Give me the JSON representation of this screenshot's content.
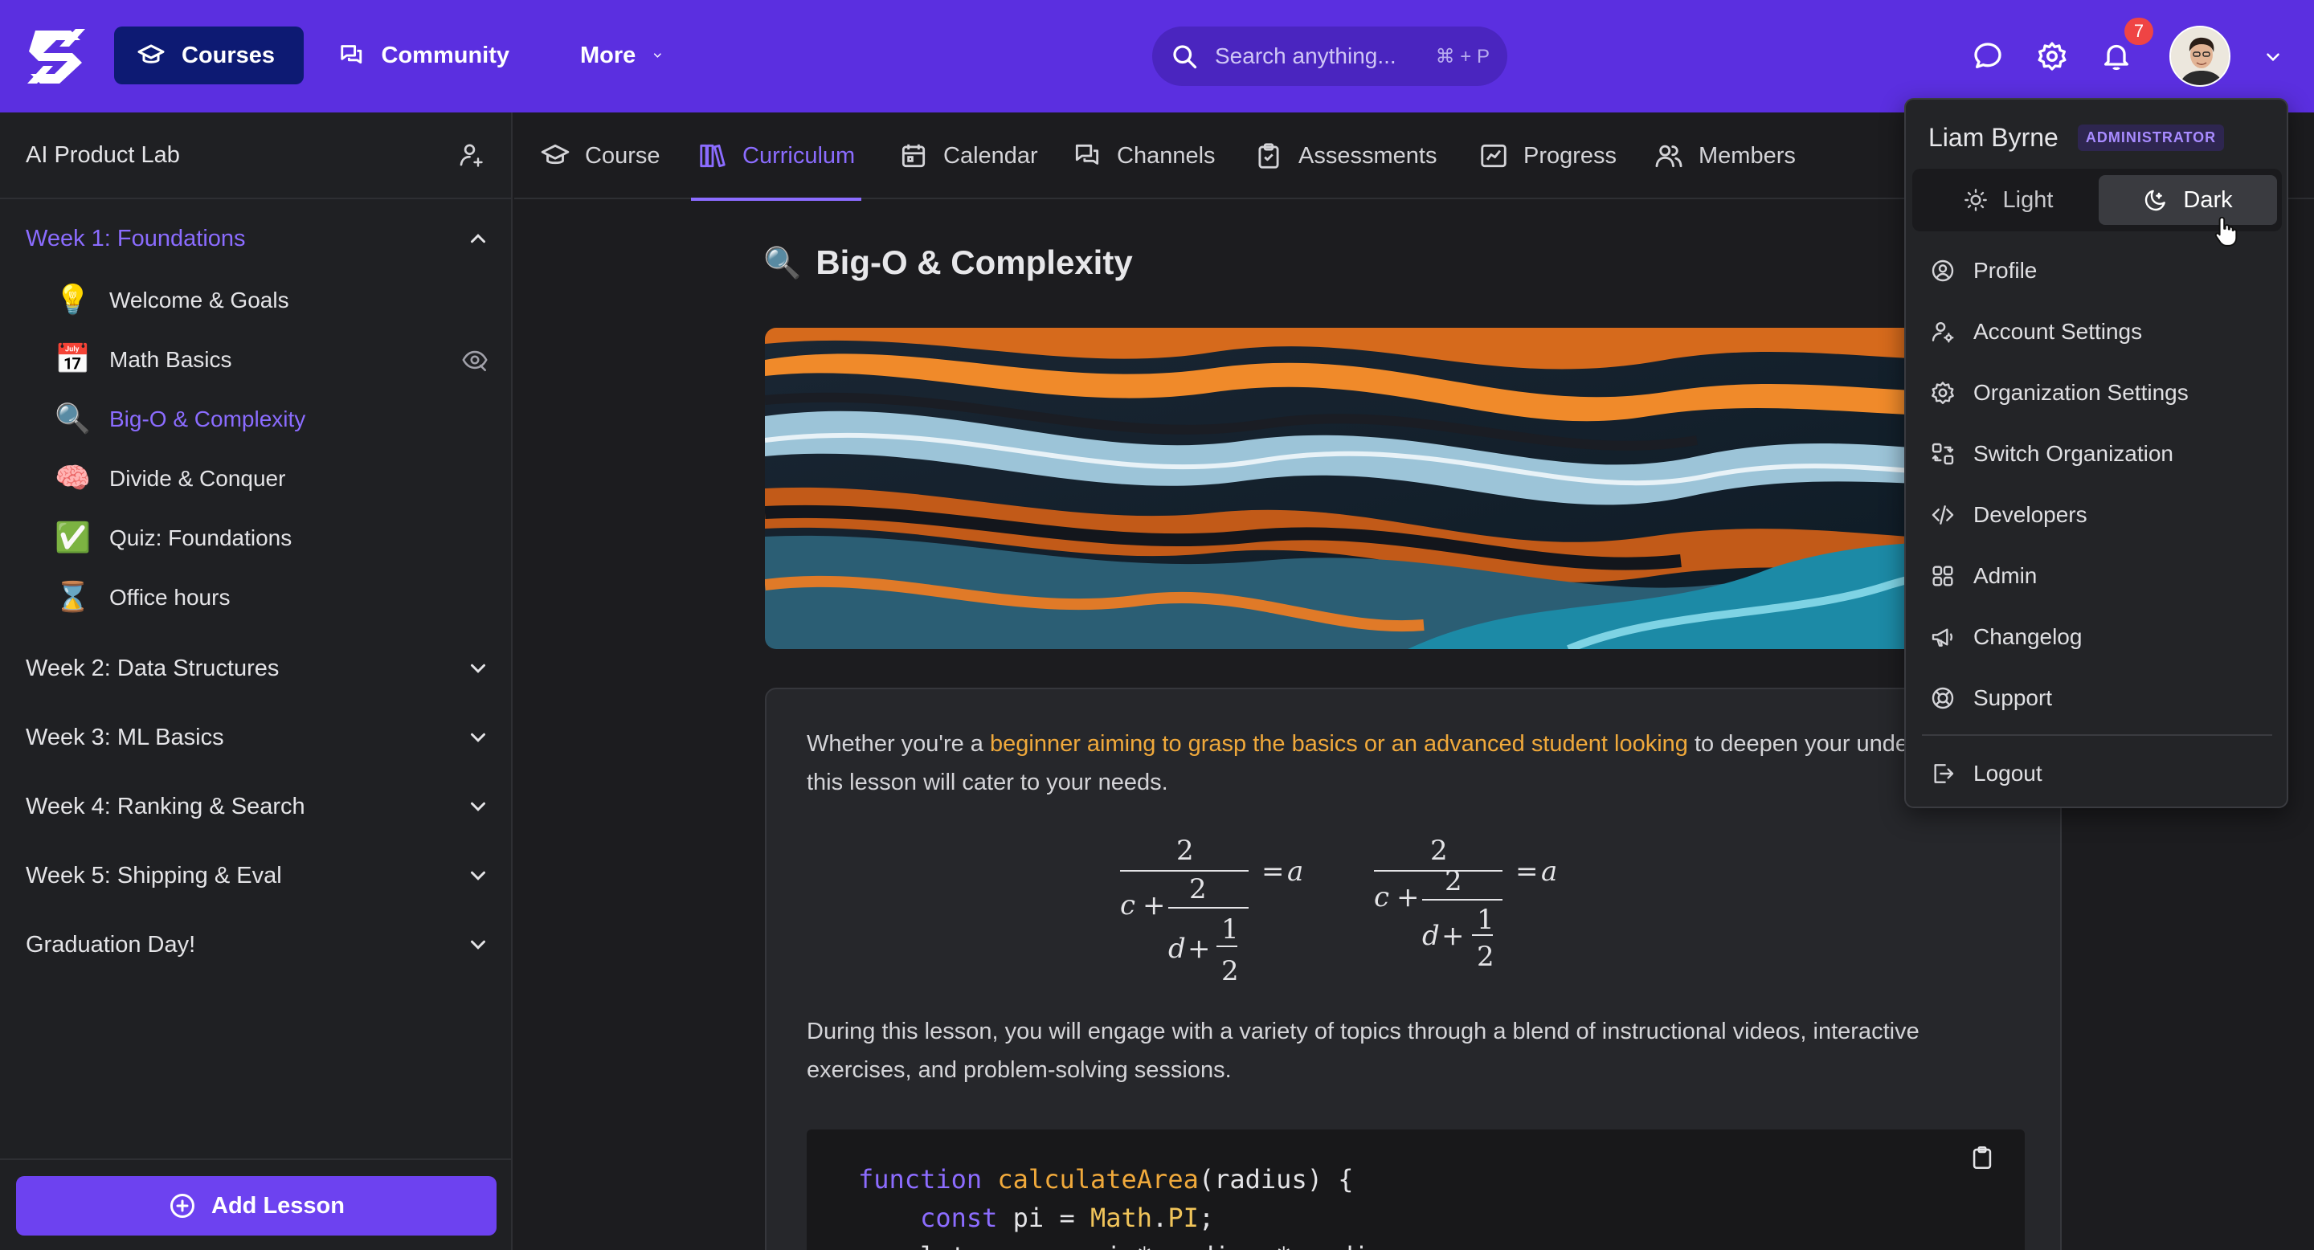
{
  "topbar": {
    "nav": [
      {
        "label": "Courses",
        "icon": "graduation-cap-icon"
      },
      {
        "label": "Community",
        "icon": "chat-bubbles-icon"
      },
      {
        "label": "More",
        "icon": "chevron-down-icon"
      }
    ],
    "search_placeholder": "Search anything...",
    "search_shortcut": "⌘ + P",
    "notification_count": "7"
  },
  "sidebar": {
    "title": "AI Product Lab",
    "weeks": [
      {
        "label": "Week 1: Foundations",
        "expanded": true
      },
      {
        "label": "Week 2: Data Structures",
        "expanded": false
      },
      {
        "label": "Week 3: ML Basics",
        "expanded": false
      },
      {
        "label": "Week 4: Ranking & Search",
        "expanded": false
      },
      {
        "label": "Week 5: Shipping & Eval",
        "expanded": false
      },
      {
        "label": "Graduation Day!",
        "expanded": false
      }
    ],
    "lessons": [
      {
        "emoji": "💡",
        "label": "Welcome & Goals"
      },
      {
        "emoji": "📅",
        "label": "Math Basics"
      },
      {
        "emoji": "🔍",
        "label": "Big-O & Complexity"
      },
      {
        "emoji": "🧠",
        "label": "Divide & Conquer"
      },
      {
        "emoji": "✅",
        "label": "Quiz: Foundations"
      },
      {
        "emoji": "⌛",
        "label": "Office hours"
      }
    ],
    "add_lesson_label": "Add Lesson"
  },
  "tabs": [
    {
      "label": "Course"
    },
    {
      "label": "Curriculum"
    },
    {
      "label": "Calendar"
    },
    {
      "label": "Channels"
    },
    {
      "label": "Assessments"
    },
    {
      "label": "Progress"
    },
    {
      "label": "Members"
    }
  ],
  "content": {
    "title_emoji": "🔍",
    "title": "Big-O & Complexity",
    "intro_before": "Whether you're a ",
    "intro_highlight": "beginner aiming to grasp the basics or an advanced student looking",
    "intro_after": " to deepen your understanding, this lesson will cater to your needs.",
    "body_paragraph": "During this lesson, you will engage with a variety of topics through a blend of instructional videos, interactive exercises, and problem-solving sessions.",
    "code": {
      "line1_kw": "function",
      "line1_fn": "calculateArea",
      "line1_rest": "(radius) {",
      "line2_kw": "const",
      "line2_mid": " pi = ",
      "line2_obj": "Math",
      "line2_dot": ".",
      "line2_prop": "PI",
      "line2_end": ";",
      "line3": "    let area = pi * radius * radius;"
    }
  },
  "menu": {
    "user_name": "Liam Byrne",
    "role": "ADMINISTRATOR",
    "theme_light": "Light",
    "theme_dark": "Dark",
    "items": [
      {
        "label": "Profile",
        "icon": "user-circle-icon"
      },
      {
        "label": "Account Settings",
        "icon": "user-gear-icon"
      },
      {
        "label": "Organization Settings",
        "icon": "gear-icon"
      },
      {
        "label": "Switch Organization",
        "icon": "switch-icon"
      },
      {
        "label": "Developers",
        "icon": "code-icon"
      },
      {
        "label": "Admin",
        "icon": "grid-icon"
      },
      {
        "label": "Changelog",
        "icon": "megaphone-icon"
      },
      {
        "label": "Support",
        "icon": "lifebuoy-icon"
      },
      {
        "label": "Logout",
        "icon": "logout-icon"
      }
    ]
  },
  "colors": {
    "topbar": "#5b2fe0",
    "accent": "#8b6cff",
    "highlight": "#f0a93b",
    "badge": "#ef4444"
  }
}
